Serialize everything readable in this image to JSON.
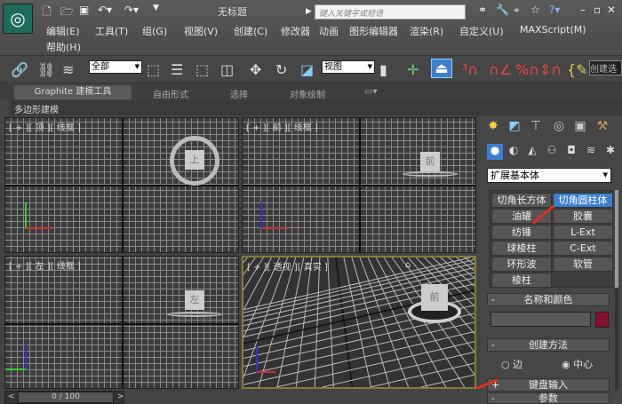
{
  "titlebar": {
    "title": "无标题",
    "search_placeholder": "键入关键字或短语",
    "icons": [
      "new-file-icon",
      "open-folder-icon",
      "save-icon",
      "undo-icon",
      "redo-icon",
      "binoculars-icon",
      "wrench-icon",
      "satellite-icon",
      "star-icon",
      "help-icon"
    ],
    "window_controls": [
      "–",
      "▫",
      "✕"
    ]
  },
  "menu": [
    "编辑(E)",
    "工具(T)",
    "组(G)",
    "视图(V)",
    "创建(C)",
    "修改器",
    "动画",
    "图形编辑器",
    "渲染(R)",
    "自定义(U)",
    "MAXScript(M)",
    "帮助(H)"
  ],
  "toolbar": {
    "selection_filter": "全部",
    "coord_system": "视图",
    "named_set": "创建选"
  },
  "ribbon": {
    "tabs": [
      "Graphite 建模工具",
      "自由形式",
      "选择",
      "对象绘制"
    ],
    "sub_tab": "多边形建模"
  },
  "viewports": [
    {
      "label": "[ + ][ 顶 ][ 线框 ]",
      "cube": "上"
    },
    {
      "label": "[ + ][ 前 ][ 线框 ]",
      "cube": "前"
    },
    {
      "label": "[ + ][ 左 ][ 线框 ]",
      "cube": "左"
    },
    {
      "label": "[ + ][ 透视 ][ 真实 ]",
      "cube": "前"
    }
  ],
  "timeline": {
    "value": "0 / 100",
    "prev": "<",
    "next": ">"
  },
  "command_panel": {
    "category": "扩展基本体",
    "objects": [
      "切角长方体",
      "切角圆柱体",
      "油罐",
      "胶囊",
      "纺锤",
      "L-Ext",
      "球棱柱",
      "C-Ext",
      "环形波",
      "软管",
      "棱柱"
    ],
    "active_object": "切角圆柱体",
    "rollouts": {
      "name_color": "名称和颜色",
      "creation_method": "创建方法",
      "keyboard_entry": "键盘输入",
      "parameters": "参数"
    },
    "creation_options": [
      "边",
      "中心"
    ],
    "selected_creation": "中心",
    "object_color": "#8a1030",
    "accent": "#3a7fd0"
  }
}
